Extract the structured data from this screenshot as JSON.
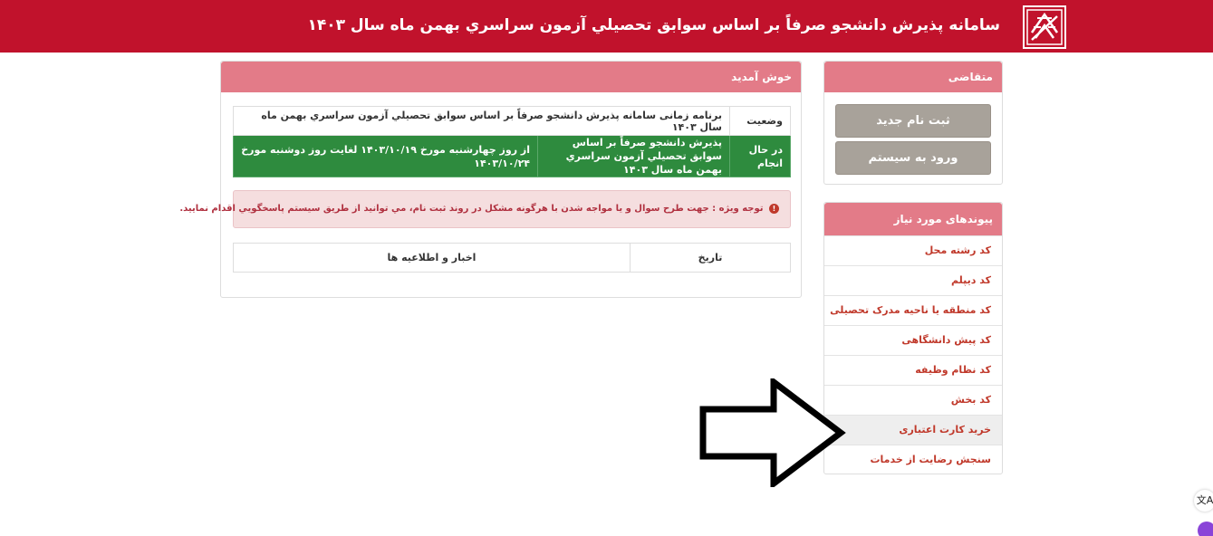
{
  "header": {
    "title": "سامانه پذیرش دانشجو صرفاً بر اساس سوابق تحصیلي آزمون سراسري بهمن ماه سال ۱۴۰۳",
    "logo_icon": "university-logo-icon",
    "bg_color": "#c1122c"
  },
  "applicant": {
    "title": "متقاضی",
    "register_label": "ثبت نام جدید",
    "login_label": "ورود به سیستم"
  },
  "links": {
    "title": "پیوندهای مورد نیاز",
    "items": [
      {
        "label": "کد رشته محل"
      },
      {
        "label": "کد دیپلم"
      },
      {
        "label": "کد منطقه یا ناحیه مدرک تحصیلی"
      },
      {
        "label": "کد پیش دانشگاهی"
      },
      {
        "label": "کد نظام وظیفه"
      },
      {
        "label": "کد بخش"
      },
      {
        "label": "خرید کارت اعتباری"
      },
      {
        "label": "سنجش رضایت از خدمات"
      }
    ]
  },
  "welcome": {
    "title": "خوش آمدید",
    "schedule": {
      "status_header": "وضعیت",
      "program_header": "برنامه زمانی سامانه پذیرش دانشجو صرفاً بر اساس سوابق تحصیلي آزمون سراسري بهمن ماه سال ۱۴۰۳",
      "row": {
        "status": "در حال انجام",
        "name": "پذیرش دانشجو صرفاً بر اساس سوابق تحصیلي آزمون سراسري بهمن ماه سال ۱۴۰۳",
        "period": "از روز چهارشنبه مورخ ۱۴۰۳/۱۰/۱۹ لغایت روز دوشنبه مورخ ۱۴۰۳/۱۰/۲۴"
      }
    },
    "alert": "توجه ویژه : جهت طرح سوال و یا مواجه شدن با هرگونه مشکل در روند ثبت نام، مي توانید از طریق سیستم پاسخگویي اقدام نمایید.",
    "news": {
      "date_header": "تاریخ",
      "news_header": "اخبار و اطلاعیه ها"
    }
  },
  "colors": {
    "accent": "#c1122c",
    "panel_header": "#e37b88",
    "status_green": "#2e8b3e",
    "button_gray": "#a8a29a",
    "link_red": "#c0392b"
  }
}
